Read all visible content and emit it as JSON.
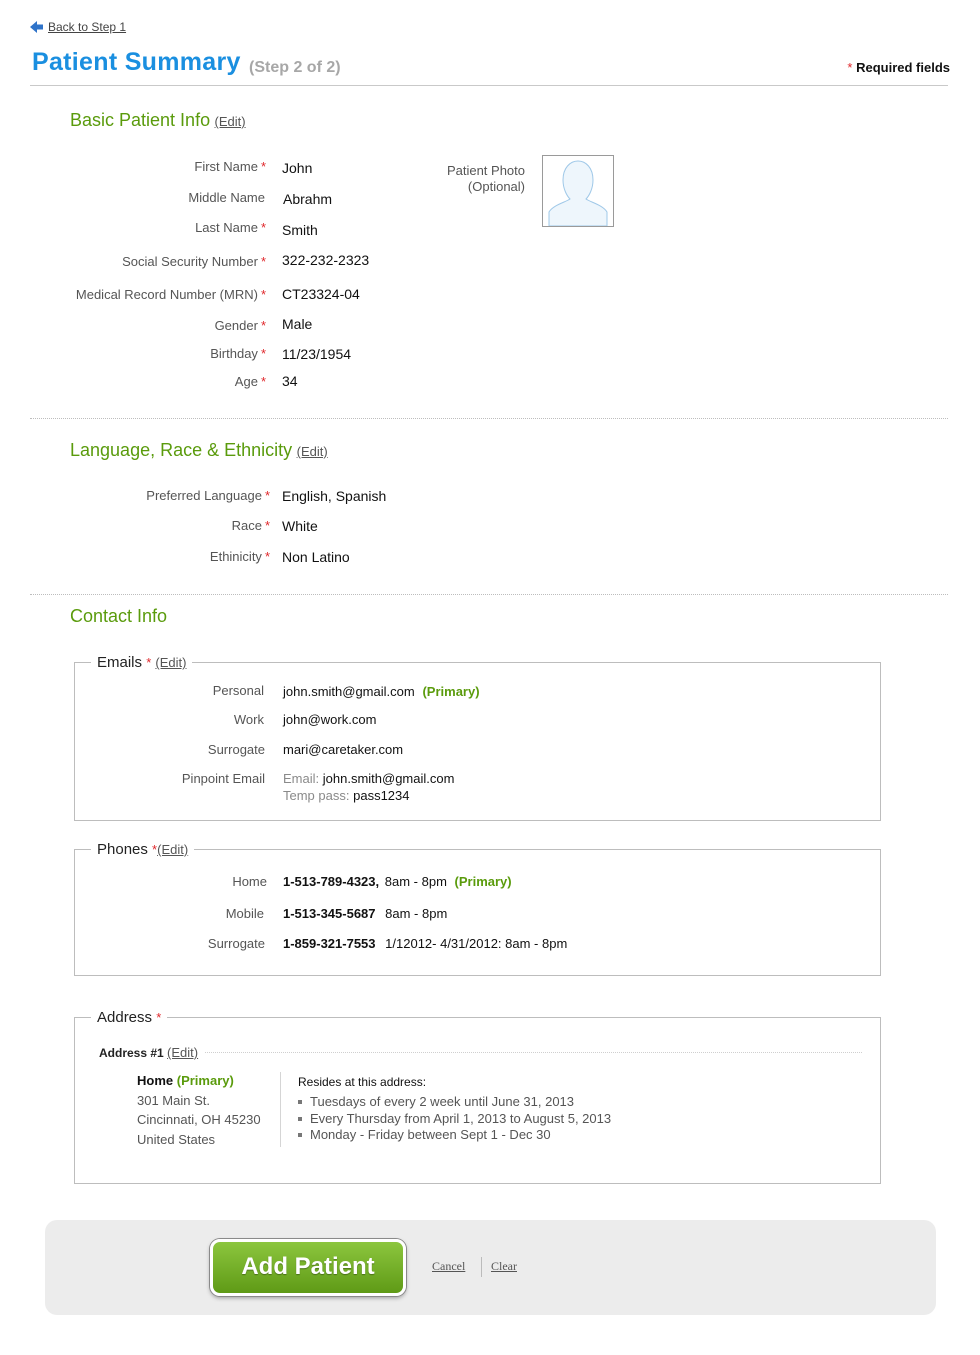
{
  "nav": {
    "back_label": "Back to Step 1"
  },
  "header": {
    "title": "Patient Summary",
    "step": "(Step 2 of 2)",
    "required_note": "Required fields"
  },
  "colors": {
    "title_blue": "#1a8fe0",
    "section_green": "#5a9b0c",
    "required_red": "#e0272b",
    "button_green": "#6fae22"
  },
  "edit_label": "(Edit)",
  "basic": {
    "heading": "Basic Patient Info",
    "photo_label_1": "Patient Photo",
    "photo_label_2": "(Optional)",
    "fields": [
      {
        "label": "First Name",
        "value": "John"
      },
      {
        "label": "Middle Name",
        "value": "Abrahm"
      },
      {
        "label": "Last Name",
        "value": "Smith"
      },
      {
        "label": "Social Security Number",
        "value": "322-232-2323"
      },
      {
        "label": "Medical Record Number (MRN)",
        "value": "CT23324-04"
      },
      {
        "label": "Gender",
        "value": "Male"
      },
      {
        "label": "Birthday",
        "value": "11/23/1954"
      },
      {
        "label": "Age",
        "value": "34"
      }
    ]
  },
  "language": {
    "heading": "Language, Race & Ethnicity",
    "fields": [
      {
        "label": "Preferred Language",
        "value": "English, Spanish"
      },
      {
        "label": "Race",
        "value": "White"
      },
      {
        "label": "Ethinicity",
        "value": "Non Latino"
      }
    ]
  },
  "contact": {
    "heading": "Contact Info",
    "emails": {
      "legend": "Emails",
      "rows": [
        {
          "label": "Personal",
          "value": "john.smith@gmail.com",
          "tag": "(Primary)"
        },
        {
          "label": "Work",
          "value": "john@work.com"
        },
        {
          "label": "Surrogate",
          "value": "mari@caretaker.com"
        }
      ],
      "pinpoint": {
        "label": "Pinpoint Email",
        "email_label": "Email:",
        "email_value": "john.smith@gmail.com",
        "pass_label": "Temp pass:",
        "pass_value": "pass1234"
      }
    },
    "phones": {
      "legend": "Phones",
      "rows": [
        {
          "label": "Home",
          "number": "1-513-789-4323,",
          "hours": "8am - 8pm",
          "tag": "(Primary)"
        },
        {
          "label": "Mobile",
          "number": "1-513-345-5687",
          "hours": "8am - 8pm"
        },
        {
          "label": "Surrogate",
          "number": "1-859-321-7553",
          "hours": "1/12012- 4/31/2012: 8am - 8pm"
        }
      ]
    },
    "address": {
      "legend": "Address",
      "entry_title": "Address #1",
      "type": "Home",
      "tag": "(Primary)",
      "lines": [
        "301 Main St.",
        "Cincinnati, OH 45230",
        "United States"
      ],
      "resides_heading": "Resides at this address:",
      "schedule": [
        "Tuesdays of every 2 week until June 31, 2013",
        "Every Thursday from April 1, 2013  to August 5, 2013",
        "Monday - Friday between Sept 1 - Dec 30"
      ]
    }
  },
  "footer": {
    "add_label": "Add Patient",
    "cancel_label": "Cancel",
    "clear_label": "Clear"
  }
}
